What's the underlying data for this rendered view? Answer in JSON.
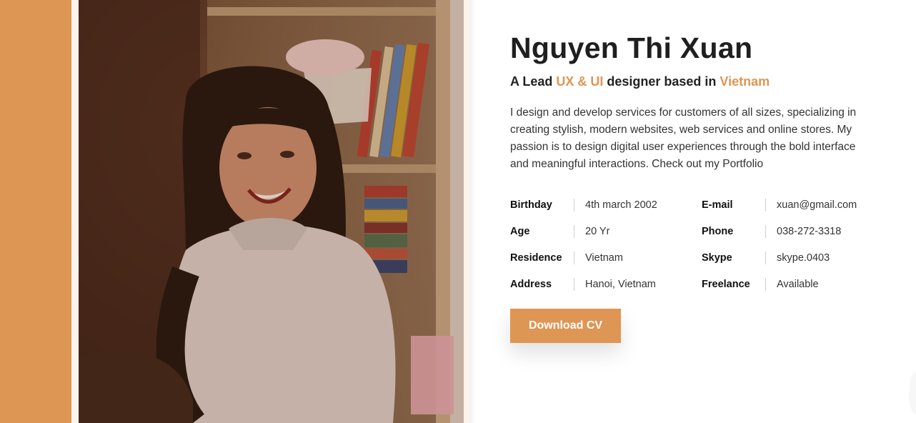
{
  "profile": {
    "name": "Nguyen Thi Xuan",
    "tagline_prefix": "A Lead ",
    "tagline_role": "UX & UI",
    "tagline_middle": " designer based in ",
    "tagline_location": "Vietnam",
    "bio": "I design and develop services for customers of all sizes, specializing in creating stylish, modern websites, web services and online stores. My passion is to design digital user experiences through the bold interface and meaningful interactions. Check out my Portfolio"
  },
  "info": [
    {
      "label": "Birthday",
      "value": "4th march 2002"
    },
    {
      "label": "Age",
      "value": "20 Yr"
    },
    {
      "label": "Residence",
      "value": "Vietnam"
    },
    {
      "label": "Address",
      "value": "Hanoi, Vietnam"
    },
    {
      "label": "E-mail",
      "value": "xuan@gmail.com"
    },
    {
      "label": "Phone",
      "value": "038-272-3318"
    },
    {
      "label": "Skype",
      "value": "skype.0403"
    },
    {
      "label": "Freelance",
      "value": "Available"
    }
  ],
  "cta": {
    "download_label": "Download CV"
  },
  "colors": {
    "accent": "#de9654",
    "text_dark": "#1f1f1f",
    "photo_frame": "#fbf3ec"
  }
}
